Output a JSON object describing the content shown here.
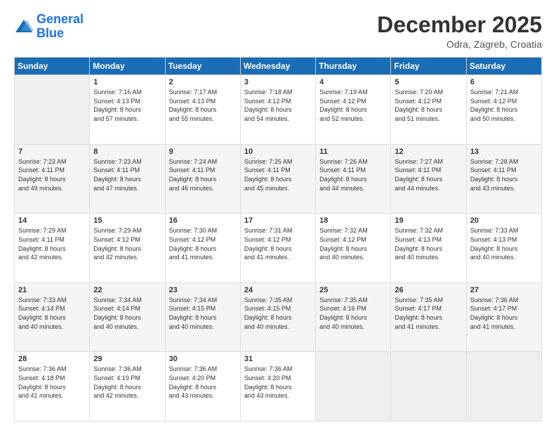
{
  "header": {
    "logo_line1": "General",
    "logo_line2": "Blue",
    "month": "December 2025",
    "location": "Odra, Zagreb, Croatia"
  },
  "weekdays": [
    "Sunday",
    "Monday",
    "Tuesday",
    "Wednesday",
    "Thursday",
    "Friday",
    "Saturday"
  ],
  "weeks": [
    [
      {
        "day": "",
        "info": ""
      },
      {
        "day": "1",
        "info": "Sunrise: 7:16 AM\nSunset: 4:13 PM\nDaylight: 8 hours\nand 57 minutes."
      },
      {
        "day": "2",
        "info": "Sunrise: 7:17 AM\nSunset: 4:13 PM\nDaylight: 8 hours\nand 55 minutes."
      },
      {
        "day": "3",
        "info": "Sunrise: 7:18 AM\nSunset: 4:12 PM\nDaylight: 8 hours\nand 54 minutes."
      },
      {
        "day": "4",
        "info": "Sunrise: 7:19 AM\nSunset: 4:12 PM\nDaylight: 8 hours\nand 52 minutes."
      },
      {
        "day": "5",
        "info": "Sunrise: 7:20 AM\nSunset: 4:12 PM\nDaylight: 8 hours\nand 51 minutes."
      },
      {
        "day": "6",
        "info": "Sunrise: 7:21 AM\nSunset: 4:12 PM\nDaylight: 8 hours\nand 50 minutes."
      }
    ],
    [
      {
        "day": "7",
        "info": "Sunrise: 7:22 AM\nSunset: 4:11 PM\nDaylight: 8 hours\nand 49 minutes."
      },
      {
        "day": "8",
        "info": "Sunrise: 7:23 AM\nSunset: 4:11 PM\nDaylight: 8 hours\nand 47 minutes."
      },
      {
        "day": "9",
        "info": "Sunrise: 7:24 AM\nSunset: 4:11 PM\nDaylight: 8 hours\nand 46 minutes."
      },
      {
        "day": "10",
        "info": "Sunrise: 7:25 AM\nSunset: 4:11 PM\nDaylight: 8 hours\nand 45 minutes."
      },
      {
        "day": "11",
        "info": "Sunrise: 7:26 AM\nSunset: 4:11 PM\nDaylight: 8 hours\nand 44 minutes."
      },
      {
        "day": "12",
        "info": "Sunrise: 7:27 AM\nSunset: 4:11 PM\nDaylight: 8 hours\nand 44 minutes."
      },
      {
        "day": "13",
        "info": "Sunrise: 7:28 AM\nSunset: 4:11 PM\nDaylight: 8 hours\nand 43 minutes."
      }
    ],
    [
      {
        "day": "14",
        "info": "Sunrise: 7:29 AM\nSunset: 4:11 PM\nDaylight: 8 hours\nand 42 minutes."
      },
      {
        "day": "15",
        "info": "Sunrise: 7:29 AM\nSunset: 4:12 PM\nDaylight: 8 hours\nand 42 minutes."
      },
      {
        "day": "16",
        "info": "Sunrise: 7:30 AM\nSunset: 4:12 PM\nDaylight: 8 hours\nand 41 minutes."
      },
      {
        "day": "17",
        "info": "Sunrise: 7:31 AM\nSunset: 4:12 PM\nDaylight: 8 hours\nand 41 minutes."
      },
      {
        "day": "18",
        "info": "Sunrise: 7:32 AM\nSunset: 4:12 PM\nDaylight: 8 hours\nand 40 minutes."
      },
      {
        "day": "19",
        "info": "Sunrise: 7:32 AM\nSunset: 4:13 PM\nDaylight: 8 hours\nand 40 minutes."
      },
      {
        "day": "20",
        "info": "Sunrise: 7:33 AM\nSunset: 4:13 PM\nDaylight: 8 hours\nand 40 minutes."
      }
    ],
    [
      {
        "day": "21",
        "info": "Sunrise: 7:33 AM\nSunset: 4:14 PM\nDaylight: 8 hours\nand 40 minutes."
      },
      {
        "day": "22",
        "info": "Sunrise: 7:34 AM\nSunset: 4:14 PM\nDaylight: 8 hours\nand 40 minutes."
      },
      {
        "day": "23",
        "info": "Sunrise: 7:34 AM\nSunset: 4:15 PM\nDaylight: 8 hours\nand 40 minutes."
      },
      {
        "day": "24",
        "info": "Sunrise: 7:35 AM\nSunset: 4:15 PM\nDaylight: 8 hours\nand 40 minutes."
      },
      {
        "day": "25",
        "info": "Sunrise: 7:35 AM\nSunset: 4:16 PM\nDaylight: 8 hours\nand 40 minutes."
      },
      {
        "day": "26",
        "info": "Sunrise: 7:35 AM\nSunset: 4:17 PM\nDaylight: 8 hours\nand 41 minutes."
      },
      {
        "day": "27",
        "info": "Sunrise: 7:36 AM\nSunset: 4:17 PM\nDaylight: 8 hours\nand 41 minutes."
      }
    ],
    [
      {
        "day": "28",
        "info": "Sunrise: 7:36 AM\nSunset: 4:18 PM\nDaylight: 8 hours\nand 41 minutes."
      },
      {
        "day": "29",
        "info": "Sunrise: 7:36 AM\nSunset: 4:19 PM\nDaylight: 8 hours\nand 42 minutes."
      },
      {
        "day": "30",
        "info": "Sunrise: 7:36 AM\nSunset: 4:20 PM\nDaylight: 8 hours\nand 43 minutes."
      },
      {
        "day": "31",
        "info": "Sunrise: 7:36 AM\nSunset: 4:20 PM\nDaylight: 8 hours\nand 43 minutes."
      },
      {
        "day": "",
        "info": ""
      },
      {
        "day": "",
        "info": ""
      },
      {
        "day": "",
        "info": ""
      }
    ]
  ]
}
